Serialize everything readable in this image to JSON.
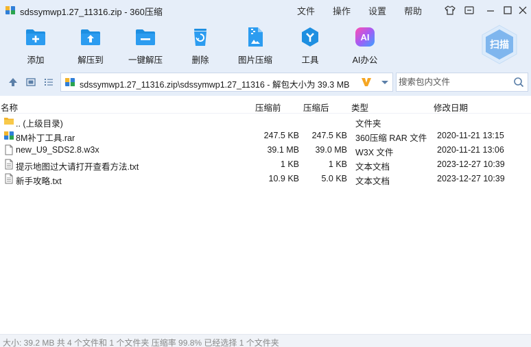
{
  "window": {
    "title": "sdssymwp1.27_11316.zip - 360压缩",
    "menu": [
      "文件",
      "操作",
      "设置",
      "帮助"
    ]
  },
  "toolbar": {
    "items": [
      {
        "label": "添加",
        "icon": "add-icon"
      },
      {
        "label": "解压到",
        "icon": "extract-to-icon"
      },
      {
        "label": "一键解压",
        "icon": "one-click-extract-icon"
      },
      {
        "label": "删除",
        "icon": "delete-icon"
      },
      {
        "label": "图片压缩",
        "icon": "image-compress-icon"
      },
      {
        "label": "工具",
        "icon": "tools-icon"
      },
      {
        "label": "AI办公",
        "icon": "ai-office-icon"
      }
    ],
    "scan_label": "扫描"
  },
  "address": {
    "path": "sdssymwp1.27_11316.zip\\sdssymwp1.27_11316 - 解包大小为 39.3 MB",
    "search_placeholder": "搜索包内文件"
  },
  "columns": {
    "name": "名称",
    "before": "压缩前",
    "after": "压缩后",
    "type": "类型",
    "date": "修改日期"
  },
  "files": [
    {
      "name": ".. (上级目录)",
      "before": "",
      "after": "",
      "type": "文件夹",
      "date": "",
      "icon": "folder-icon"
    },
    {
      "name": "8M补丁工具.rar",
      "before": "247.5 KB",
      "after": "247.5 KB",
      "type": "360压缩 RAR 文件",
      "date": "2020-11-21 13:15",
      "icon": "rar-archive-icon"
    },
    {
      "name": "new_U9_SDS2.8.w3x",
      "before": "39.1 MB",
      "after": "39.0 MB",
      "type": "W3X 文件",
      "date": "2020-11-21 13:06",
      "icon": "blank-file-icon"
    },
    {
      "name": "提示地图过大请打开查看方法.txt",
      "before": "1 KB",
      "after": "1 KB",
      "type": "文本文档",
      "date": "2023-12-27 10:39",
      "icon": "text-file-icon"
    },
    {
      "name": "新手攻略.txt",
      "before": "10.9 KB",
      "after": "5.0 KB",
      "type": "文本文档",
      "date": "2023-12-27 10:39",
      "icon": "text-file-icon"
    }
  ],
  "status": {
    "text": "大小: 39.2 MB 共 4 个文件和 1 个文件夹 压缩率 99.8% 已经选择 1 个文件夹"
  },
  "colors": {
    "chrome_bg": "#e6eef9",
    "accent_blue": "#1e8fe1",
    "scan_blue": "#7fb6ee"
  }
}
